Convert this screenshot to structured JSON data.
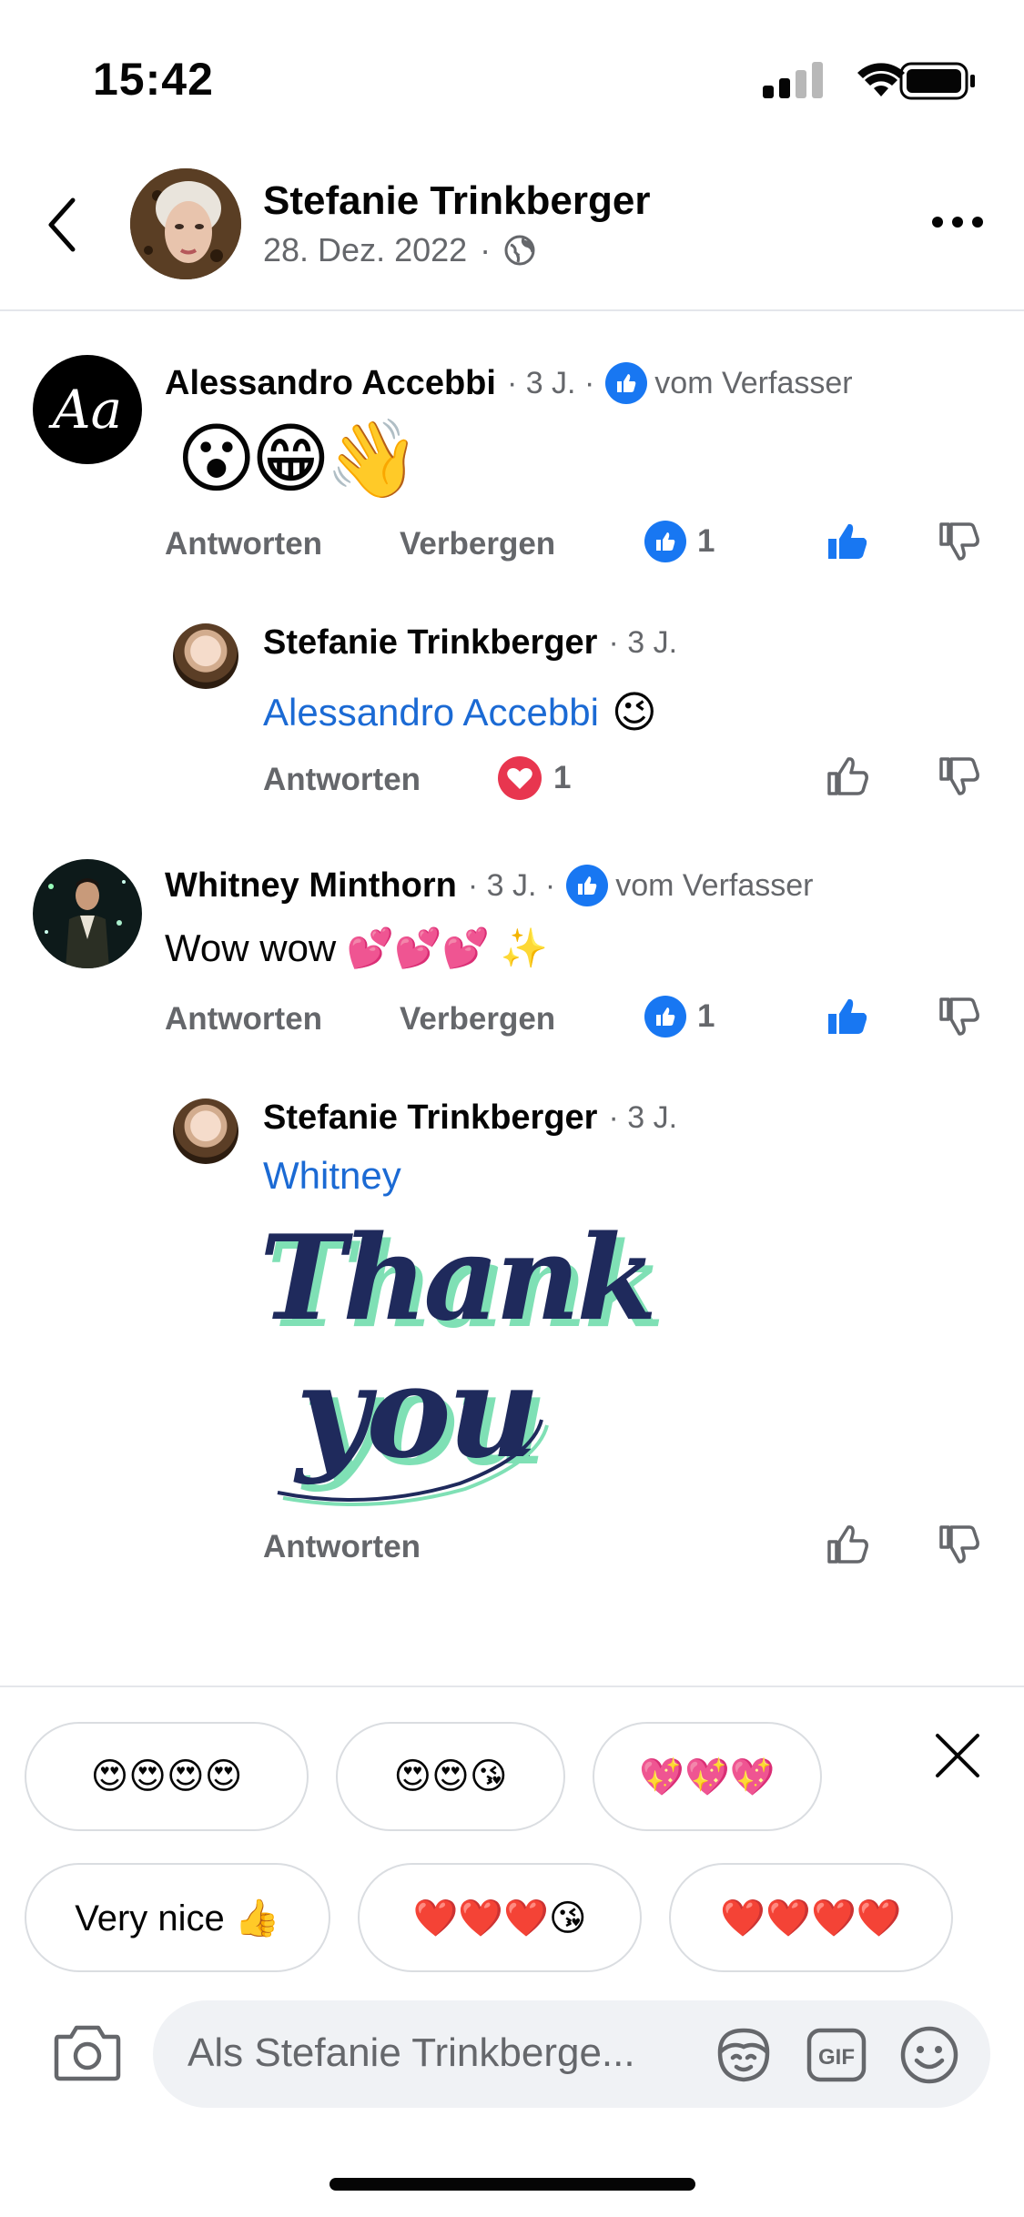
{
  "status_bar": {
    "time": "15:42"
  },
  "header": {
    "name": "Stefanie Trinkberger",
    "date": "28. Dez. 2022",
    "separator": "·"
  },
  "comments": [
    {
      "name": "Alessandro Accebbi",
      "avatar_text": "Aa",
      "age": "· 3 J. ·",
      "author_like_label": "vom Verfasser",
      "content": "😮😁👋",
      "reply_label": "Antworten",
      "hide_label": "Verbergen",
      "reaction_count": "1"
    },
    {
      "name": "Stefanie Trinkberger",
      "age": "· 3 J.",
      "mention": "Alessandro Accebbi",
      "content_suffix": "😉",
      "reply_label": "Antworten",
      "reaction_count": "1"
    },
    {
      "name": "Whitney Minthorn",
      "age": "· 3 J. ·",
      "author_like_label": "vom Verfasser",
      "content": "Wow wow 💕💕💕 ✨",
      "reply_label": "Antworten",
      "hide_label": "Verbergen",
      "reaction_count": "1"
    },
    {
      "name": "Stefanie Trinkberger",
      "age": "· 3 J.",
      "mention": "Whitney",
      "sticker_text_1": "Thank",
      "sticker_text_2": "you",
      "reply_label": "Antworten"
    }
  ],
  "suggestions": {
    "row1": [
      "😍😍😍😍",
      "😍😍😘",
      "💖💖💖"
    ],
    "row2": [
      "Very nice 👍",
      "❤️❤️❤️😘",
      "❤️❤️❤️❤️"
    ]
  },
  "composer": {
    "placeholder": "Als Stefanie Trinkberge..."
  },
  "icons": [
    "back-icon",
    "globe-icon",
    "more-icon",
    "like-icon",
    "dislike-icon",
    "heart-icon",
    "close-icon",
    "camera-icon",
    "avatar-sticker-icon",
    "gif-icon",
    "emoji-icon"
  ],
  "colors": {
    "accent": "#1877f2",
    "mention": "#1b6ad4",
    "heart": "#e8364f",
    "secondary_text": "#65676b"
  }
}
